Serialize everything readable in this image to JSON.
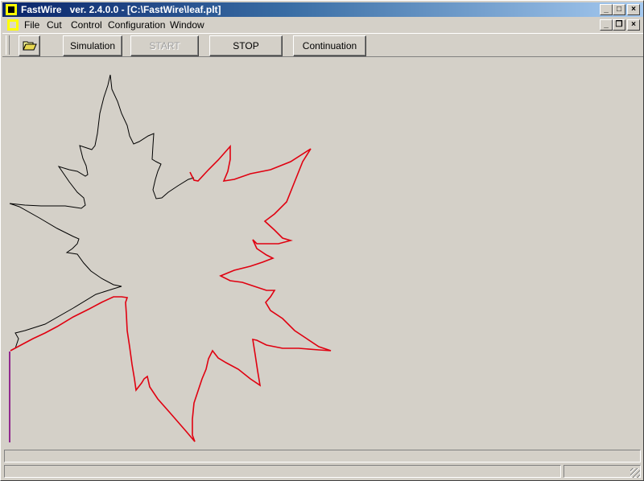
{
  "window": {
    "title": "FastWire   ver. 2.4.0.0 - [C:\\FastWire\\leaf.plt]",
    "app_icon": "app-icon",
    "caption_buttons": {
      "minimize": "_",
      "maximize": "□",
      "close": "×"
    },
    "doc_caption_buttons": {
      "minimize": "_",
      "restore": "❐",
      "close": "×"
    }
  },
  "menu": {
    "items": [
      {
        "label": "File"
      },
      {
        "label": "Cut"
      },
      {
        "label": "Control"
      },
      {
        "label": "Configuration"
      },
      {
        "label": "Window"
      }
    ]
  },
  "toolbar": {
    "open_icon": "folder-open-icon",
    "buttons": [
      {
        "label": "Simulation",
        "enabled": true
      },
      {
        "label": "START",
        "enabled": false
      },
      {
        "label": "STOP",
        "enabled": true
      },
      {
        "label": "Continuation",
        "enabled": true
      }
    ]
  },
  "drawing": {
    "colors": {
      "pending": "#000000",
      "cut": "#e00010",
      "lead": "#800080"
    },
    "description": "Maple leaf cutting path: black = not yet cut, red = cut path, purple = lead-in"
  },
  "statusbar": {
    "line1": "",
    "panel1": "",
    "panel2": ""
  }
}
